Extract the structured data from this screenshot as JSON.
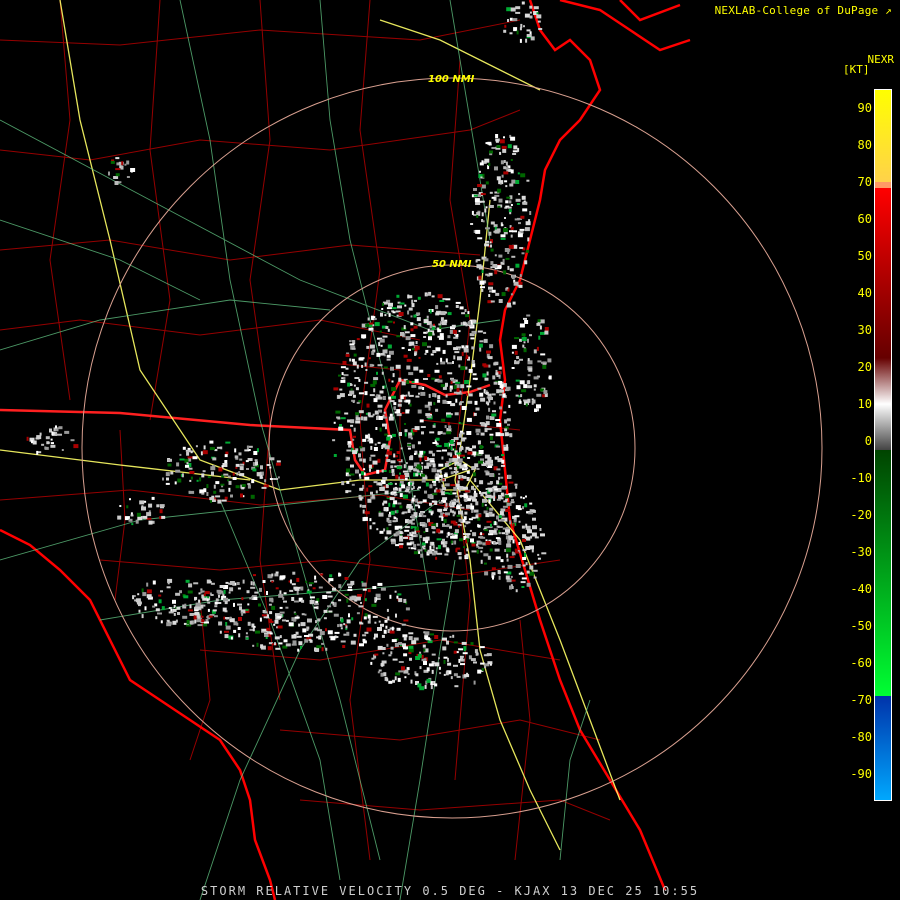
{
  "header": {
    "credit": "NEXLAB-College of DuPage",
    "product": "NEXR",
    "unit": "[KT]"
  },
  "rings": {
    "outer_label": "100 NMI",
    "inner_label": "50 NMI",
    "color": "#d9a090"
  },
  "legend": {
    "ticks": [
      "90",
      "80",
      "70",
      "60",
      "50",
      "40",
      "30",
      "20",
      "10",
      "0",
      "-10",
      "-20",
      "-30",
      "-40",
      "-50",
      "-60",
      "-70",
      "-80",
      "-90"
    ],
    "colors": {
      "high_yellow": "#ffff00",
      "orange": "#ff9966",
      "red": "#ff0000",
      "dark_red": "#660000",
      "gray": "#999999",
      "dark_green": "#006600",
      "green": "#00ff33",
      "blue": "#0066cc",
      "light_blue": "#00aaff"
    }
  },
  "map_colors": {
    "county_lines": "#b00000",
    "state_lines": "#ff2020",
    "coast": "#ff0000",
    "highways": "#ffff66",
    "roads": "#66cc88"
  },
  "footer": {
    "caption": "STORM RELATIVE VELOCITY 0.5 DEG - KJAX 13 DEC 25 10:55"
  }
}
